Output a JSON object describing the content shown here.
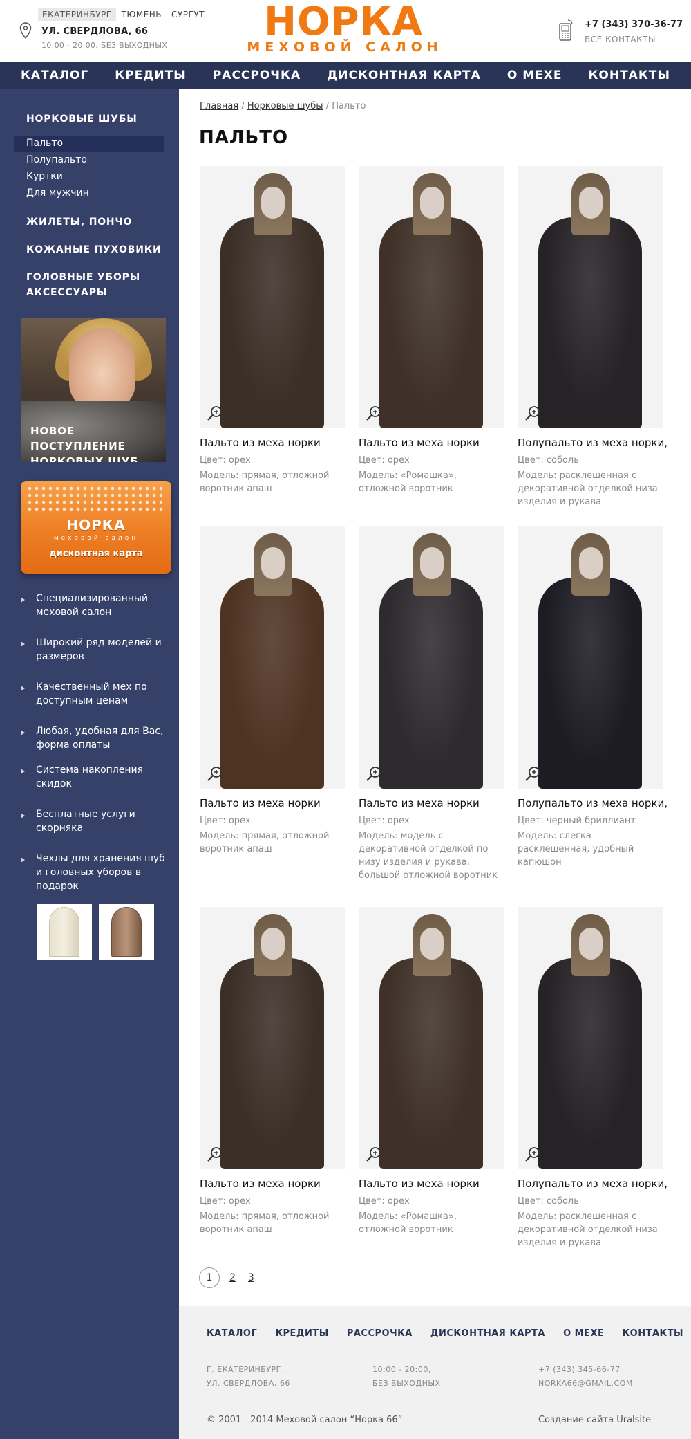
{
  "header": {
    "cities": [
      "ЕКАТЕРИНБУРГ",
      "ТЮМЕНЬ",
      "СУРГУТ"
    ],
    "address": "УЛ. СВЕРДЛОВА, 66",
    "hours": "10:00 - 20:00, БЕЗ ВЫХОДНЫХ",
    "logo_main": "НОРКА",
    "logo_sub": "МЕХОВОЙ САЛОН",
    "phone": "+7 (343) 370-36-77",
    "contacts_link": "ВСЕ КОНТАКТЫ"
  },
  "nav": [
    "КАТАЛОГ",
    "КРЕДИТЫ",
    "РАССРОЧКА",
    "ДИСКОНТНАЯ КАРТА",
    "О МЕХЕ",
    "КОНТАКТЫ"
  ],
  "sidebar": {
    "section1": "НОРКОВЫЕ ШУБЫ",
    "subitems": [
      "Пальто",
      "Полупальто",
      "Куртки",
      "Для мужчин"
    ],
    "section2": "ЖИЛЕТЫ, ПОНЧО",
    "section3": "КОЖАНЫЕ ПУХОВИКИ",
    "section4a": "ГОЛОВНЫЕ УБОРЫ",
    "section4b": "АКСЕССУАРЫ",
    "promo1_line1": "НОВОЕ ПОСТУПЛЕНИЕ",
    "promo1_line2": "НОРКОВЫХ ШУБ",
    "promo2_logo": "НОРКА",
    "promo2_sub": "меховой салон",
    "promo2_card": "дисконтная карта",
    "features": [
      "Специализированный меховой салон",
      "Широкий ряд моделей и размеров",
      "Качественный мех по доступным ценам",
      "Любая, удобная для Вас, форма оплаты",
      "Система накопления скидок",
      "Бесплатные услуги скорняка",
      "Чехлы для хранения шуб и головных уборов в подарок"
    ]
  },
  "breadcrumb": {
    "home": "Главная",
    "sep1": " / ",
    "parent": "Норковые шубы",
    "sep2": " / ",
    "current": "Пальто"
  },
  "page_title": "ПАЛЬТО",
  "products": [
    {
      "name": "Пальто из меха норки",
      "color": "Цвет: орех",
      "model": "Модель: прямая, отложной воротник апаш",
      "coat_color": "#3b2f27"
    },
    {
      "name": "Пальто из меха норки",
      "color": "Цвет: орех",
      "model": "Модель: «Ромашка», отложной воротник",
      "coat_color": "#3f3128"
    },
    {
      "name": "Полупальто из меха норки,",
      "color": "Цвет: соболь",
      "model": "Модель: расклешенная с декоративной отделкой низа изделия и рукава",
      "coat_color": "#262226"
    },
    {
      "name": "Пальто из меха норки",
      "color": "Цвет: орех",
      "model": "Модель: прямая, отложной воротник апаш",
      "coat_color": "#4e3322"
    },
    {
      "name": "Пальто из меха норки",
      "color": "Цвет: орех",
      "model": "Модель: модель с декоративной отделкой по низу изделия и рукава, большой отложной воротник",
      "coat_color": "#2e2a30"
    },
    {
      "name": "Полупальто из меха норки,",
      "color": "Цвет: черный бриллиант",
      "model": "Модель: слегка расклешенная, удобный капюшон",
      "coat_color": "#1d1b24"
    },
    {
      "name": "Пальто из меха норки",
      "color": "Цвет: орех",
      "model": "Модель: прямая, отложной воротник апаш",
      "coat_color": "#3b2f27"
    },
    {
      "name": "Пальто из меха норки",
      "color": "Цвет: орех",
      "model": "Модель: «Ромашка», отложной воротник",
      "coat_color": "#3f3128"
    },
    {
      "name": "Полупальто из меха норки,",
      "color": "Цвет: соболь",
      "model": "Модель: расклешенная с декоративной отделкой низа изделия и рукава",
      "coat_color": "#262226"
    }
  ],
  "pagination": [
    "1",
    "2",
    "3"
  ],
  "footer": {
    "nav": [
      "КАТАЛОГ",
      "КРЕДИТЫ",
      "РАССРОЧКА",
      "ДИСКОНТНАЯ КАРТА",
      "О МЕХЕ",
      "КОНТАКТЫ"
    ],
    "addr1": "Г. ЕКАТЕРИНБУРГ ,",
    "addr2": "УЛ. СВЕРДЛОВА, 66",
    "hours1": "10:00 - 20:00,",
    "hours2": "БЕЗ ВЫХОДНЫХ",
    "phone": "+7 (343) 345-66-77",
    "email": "NORKA66@GMAIL.COM",
    "copyright": "© 2001 - 2014  Меховой салон “Норка 66”",
    "madeby": "Создание сайта Uralsite"
  },
  "colors": {
    "accent": "#f07a11",
    "nav_bg": "#2a3456",
    "sidebar_bg": "#364169"
  },
  "icons": [
    "location-pin-icon",
    "phone-icon",
    "zoom-icon",
    "arrow-right-icon"
  ]
}
